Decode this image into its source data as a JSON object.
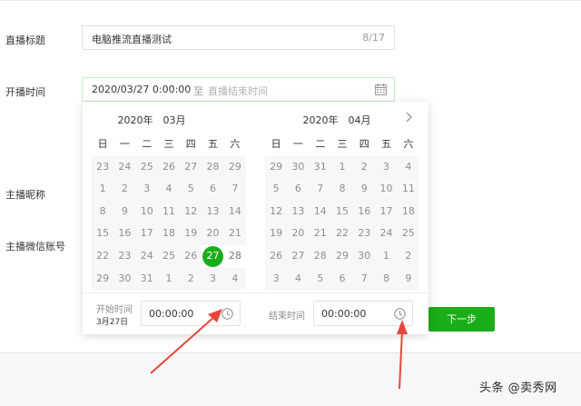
{
  "form": {
    "title_label": "直播标题",
    "title_value": "电脑推流直播测试",
    "title_count": "8/17",
    "time_label": "开播时间",
    "start_value": "2020/03/27 0:00:00",
    "range_separator": "至",
    "end_placeholder": "直播结束时间",
    "nickname_label": "主播昵称",
    "wechat_label": "主播微信账号",
    "next_button": "下一步"
  },
  "picker": {
    "weekdays": [
      "日",
      "一",
      "二",
      "三",
      "四",
      "五",
      "六"
    ],
    "left": {
      "title": "2020年　03月",
      "rows": [
        [
          "23",
          "24",
          "25",
          "26",
          "27",
          "28",
          "29"
        ],
        [
          "1",
          "2",
          "3",
          "4",
          "5",
          "6",
          "7"
        ],
        [
          "8",
          "9",
          "10",
          "11",
          "12",
          "13",
          "14"
        ],
        [
          "15",
          "16",
          "17",
          "18",
          "19",
          "20",
          "21"
        ],
        [
          "22",
          "23",
          "24",
          "25",
          "26",
          "27",
          "28"
        ],
        [
          "29",
          "30",
          "31",
          "1",
          "2",
          "3",
          "4"
        ]
      ]
    },
    "right": {
      "title": "2020年　04月",
      "rows": [
        [
          "29",
          "30",
          "31",
          "1",
          "2",
          "3",
          "4"
        ],
        [
          "5",
          "6",
          "7",
          "8",
          "9",
          "10",
          "11"
        ],
        [
          "12",
          "13",
          "14",
          "15",
          "16",
          "17",
          "18"
        ],
        [
          "19",
          "20",
          "21",
          "22",
          "23",
          "24",
          "25"
        ],
        [
          "26",
          "27",
          "28",
          "29",
          "30",
          "1",
          "2"
        ],
        [
          "3",
          "4",
          "5",
          "6",
          "7",
          "8",
          "9"
        ]
      ]
    },
    "start_time_label": "开始时间",
    "start_date_sub": "3月27日",
    "start_time_value": "00:00:00",
    "end_time_label": "结束时间",
    "end_time_value": "00:00:00"
  },
  "watermark": "头条 @卖秀网",
  "colors": {
    "accent": "#1aad19",
    "arrow": "#e8453c"
  }
}
